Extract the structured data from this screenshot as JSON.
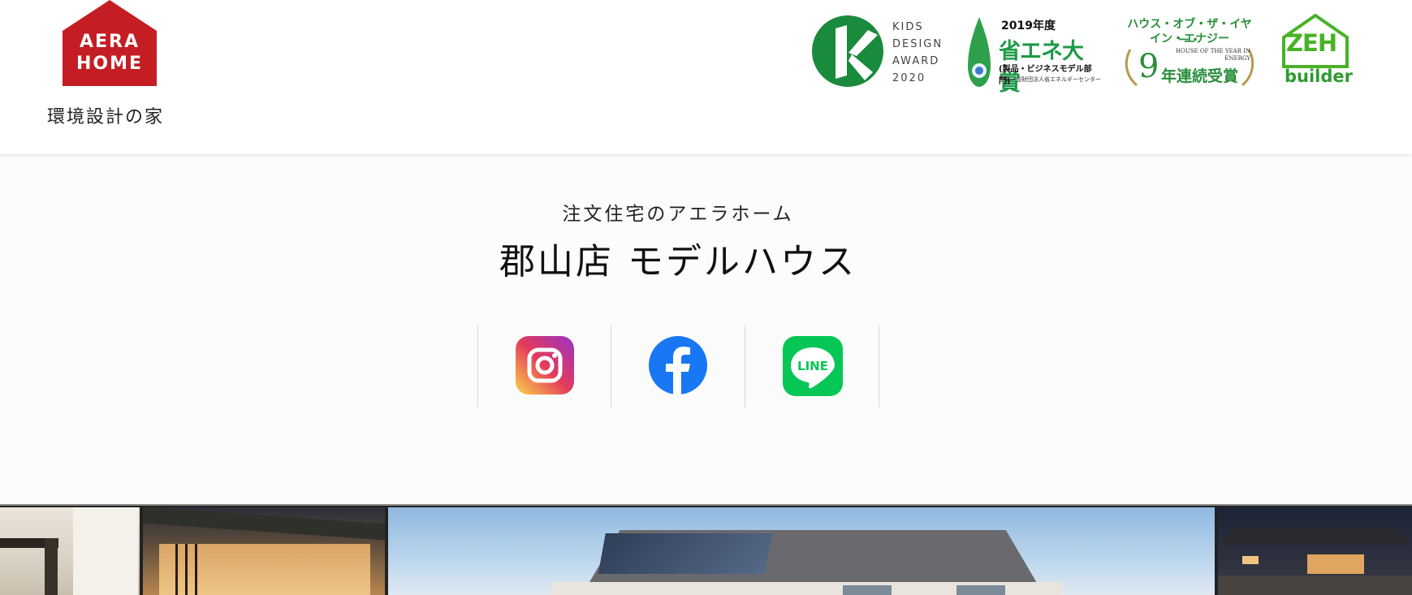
{
  "brand": {
    "logo_line1": "AERA",
    "logo_line2": "HOME",
    "logo_subtitle": "環境設計の家",
    "brand_red": "#c41e24"
  },
  "awards": {
    "kids_design": {
      "lines": [
        "KIDS",
        "DESIGN",
        "AWARD",
        "2020"
      ],
      "icon": "kids-design-k-icon",
      "color": "#1a8a3c"
    },
    "energy_saving": {
      "year": "2019年度",
      "title": "省エネ大賞",
      "sub": "(製品・ビジネスモデル部門)",
      "org": "主催一般財団法人省エネルギーセンター",
      "icon": "energy-drop-icon"
    },
    "house_of_year": {
      "line1": "ハウス・オブ・ザ・イヤー・",
      "line2": "イン・エナジー",
      "english": "HOUSE OF THE YEAR IN ENERGY",
      "number": "9",
      "bottom": "年連続受賞",
      "icon": "laurel-icon"
    },
    "zeh": {
      "label": "ZEH",
      "sub": "builder",
      "icon": "zeh-house-icon"
    }
  },
  "page": {
    "subtitle": "注文住宅のアエラホーム",
    "title": "郡山店 モデルハウス"
  },
  "social": [
    {
      "name": "instagram",
      "icon": "instagram-icon"
    },
    {
      "name": "facebook",
      "icon": "facebook-icon"
    },
    {
      "name": "line",
      "icon": "line-icon",
      "label": "LINE"
    }
  ],
  "colors": {
    "instagram_gradient": [
      "#fdd549",
      "#e33a5b",
      "#9a33c6"
    ],
    "facebook_blue": "#1877f2",
    "line_green": "#06c755"
  }
}
